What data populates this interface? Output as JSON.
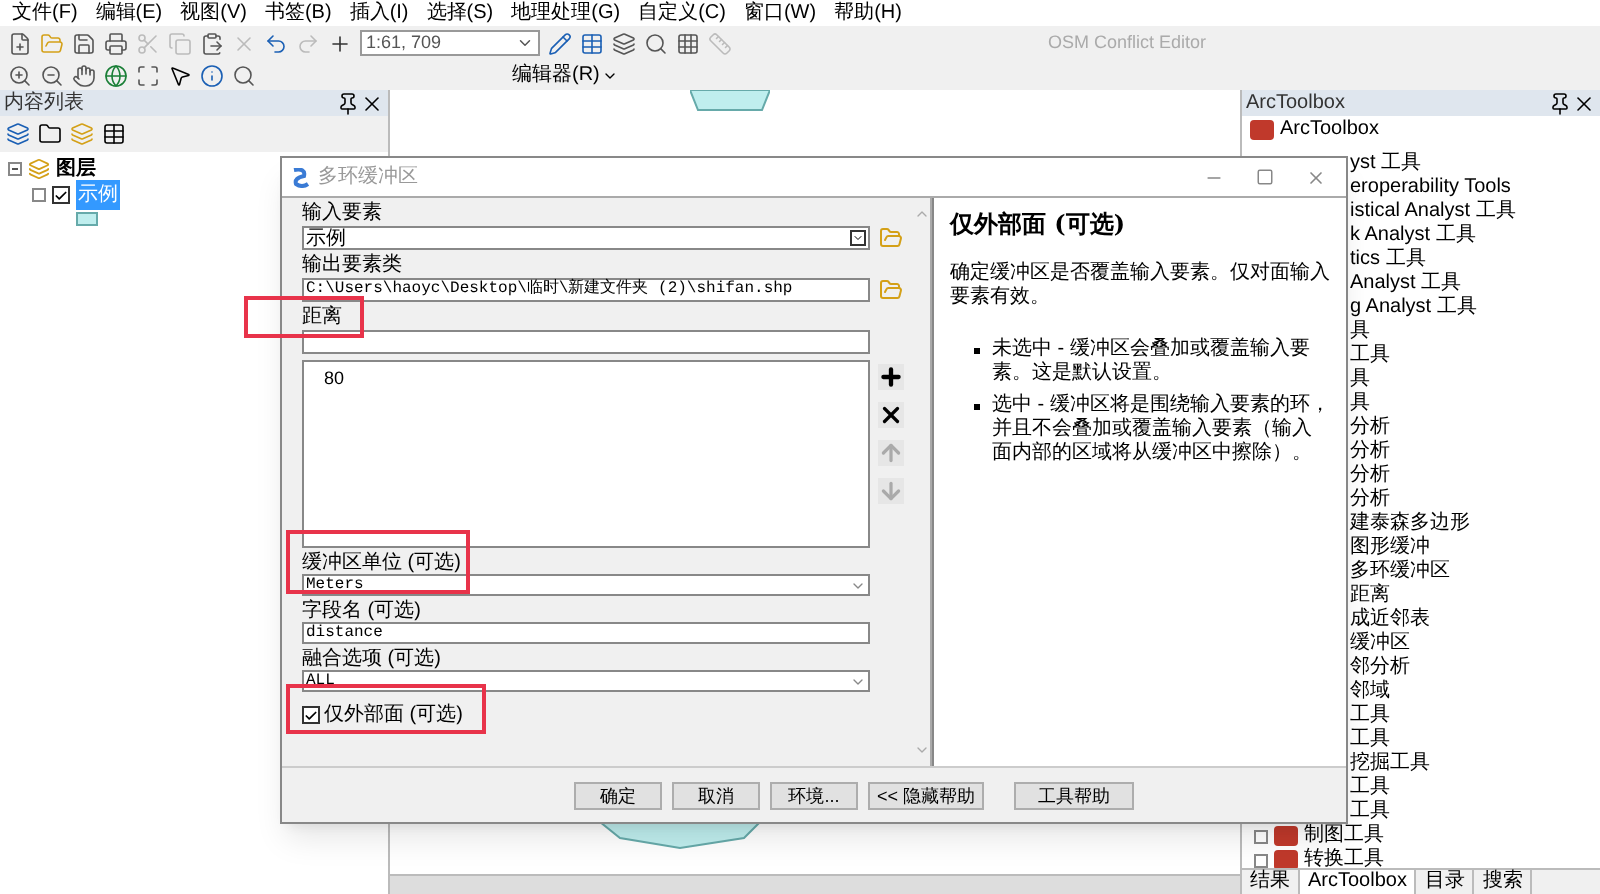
{
  "menu_bar": [
    "文件(F)",
    "编辑(E)",
    "视图(V)",
    "书签(B)",
    "插入(I)",
    "选择(S)",
    "地理处理(G)",
    "自定义(C)",
    "窗口(W)",
    "帮助(H)"
  ],
  "toolbar": {
    "scale": "1:61, 709",
    "osm_label": "OSM Conflict Editor",
    "editor_menu": "编辑器(R)"
  },
  "contents_panel": {
    "title": "内容列表",
    "tree": [
      {
        "label": "图层",
        "expanded": true,
        "children": [
          {
            "label": "示例",
            "checked": true,
            "selected": true
          }
        ]
      }
    ]
  },
  "toolbox_panel": {
    "title": "ArcToolbox",
    "root": "ArcToolbox",
    "items": [
      {
        "label": "yst 工具",
        "kind": "clipped"
      },
      {
        "label": "eroperability Tools",
        "kind": "clipped"
      },
      {
        "label": "istical Analyst 工具",
        "kind": "clipped"
      },
      {
        "label": "k Analyst 工具",
        "kind": "clipped"
      },
      {
        "label": "tics 工具",
        "kind": "clipped"
      },
      {
        "label": "Analyst 工具",
        "kind": "clipped"
      },
      {
        "label": "g Analyst 工具",
        "kind": "clipped"
      },
      {
        "label": "具",
        "kind": "clipped"
      },
      {
        "label": "工具",
        "kind": "clipped"
      },
      {
        "label": "具",
        "kind": "clipped"
      },
      {
        "label": "具",
        "kind": "clipped"
      },
      {
        "label": "分析",
        "kind": "clipped"
      },
      {
        "label": "分析",
        "kind": "clipped"
      },
      {
        "label": "分析",
        "kind": "clipped"
      },
      {
        "label": "分析",
        "kind": "clipped"
      },
      {
        "label": "建泰森多边形",
        "kind": "clipped"
      },
      {
        "label": "图形缓冲",
        "kind": "clipped"
      },
      {
        "label": "多环缓冲区",
        "kind": "clipped"
      },
      {
        "label": "距离",
        "kind": "clipped"
      },
      {
        "label": "成近邻表",
        "kind": "clipped"
      },
      {
        "label": "缓冲区",
        "kind": "clipped"
      },
      {
        "label": "邻分析",
        "kind": "clipped"
      },
      {
        "label": "邻域",
        "kind": "clipped"
      },
      {
        "label": "工具",
        "kind": "clipped"
      },
      {
        "label": "工具",
        "kind": "clipped"
      },
      {
        "label": "挖掘工具",
        "kind": "clipped"
      },
      {
        "label": "工具",
        "kind": "clipped"
      },
      {
        "label": "工具",
        "kind": "clipped"
      },
      {
        "label": "制图工具",
        "kind": "toolset"
      },
      {
        "label": "转换工具",
        "kind": "toolset"
      }
    ],
    "tabs": [
      {
        "label": "结果",
        "selected": false
      },
      {
        "label": "ArcToolbox",
        "selected": true
      },
      {
        "label": "目录",
        "selected": false
      },
      {
        "label": "搜索",
        "selected": false
      }
    ]
  },
  "dialog": {
    "title": "多环缓冲区",
    "input_features": {
      "label": "输入要素",
      "value": "示例"
    },
    "output_class": {
      "label": "输出要素类",
      "value": "C:\\Users\\haoyc\\Desktop\\临时\\新建文件夹 (2)\\shifan.shp"
    },
    "distances": {
      "label": "距离",
      "items": [
        "80"
      ]
    },
    "buffer_unit": {
      "label": "缓冲区单位 (可选)",
      "value": "Meters"
    },
    "field_name": {
      "label": "字段名 (可选)",
      "value": "distance"
    },
    "dissolve": {
      "label": "融合选项 (可选)",
      "value": "ALL"
    },
    "outside_only": {
      "label": "仅外部面 (可选)",
      "checked": true
    },
    "buttons": [
      "确定",
      "取消",
      "环境...",
      "<< 隐藏帮助",
      "工具帮助"
    ],
    "help": {
      "title": "仅外部面 (可选)",
      "body": "确定缓冲区是否覆盖输入要素。仅对面输入要素有效。",
      "bullets": [
        "未选中 - 缓冲区会叠加或覆盖输入要素。这是默认设置。",
        "选中 - 缓冲区将是围绕输入要素的环，并且不会叠加或覆盖输入要素（输入面内部的区域将从缓冲区中擦除）。"
      ]
    }
  }
}
